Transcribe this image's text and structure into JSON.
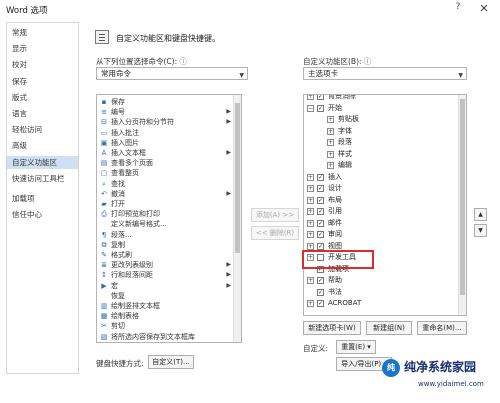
{
  "window": {
    "title": "Word 选项",
    "help_label": "?",
    "close_label": "✕"
  },
  "sidebar": {
    "items": [
      {
        "label": "常规",
        "selected": false
      },
      {
        "label": "显示",
        "selected": false
      },
      {
        "label": "校对",
        "selected": false
      },
      {
        "label": "保存",
        "selected": false
      },
      {
        "label": "版式",
        "selected": false
      },
      {
        "label": "语言",
        "selected": false
      },
      {
        "label": "轻松访问",
        "selected": false
      },
      {
        "label": "高级",
        "selected": false
      },
      {
        "label": "自定义功能区",
        "selected": true
      },
      {
        "label": "快速访问工具栏",
        "selected": false
      },
      {
        "label": "加载项",
        "selected": false
      },
      {
        "label": "信任中心",
        "selected": false
      }
    ]
  },
  "header": {
    "text": "自定义功能区和键盘快捷键。"
  },
  "left_panel": {
    "choose_label": "从下列位置选择命令(C):",
    "info_icon": "ⓘ",
    "choose_value": "常用命令",
    "commands": [
      {
        "label": "保存",
        "icon": "▪",
        "has_submenu": false
      },
      {
        "label": "编号",
        "icon": "≡",
        "has_submenu": true
      },
      {
        "label": "插入分页符和分节符",
        "icon": "⊟",
        "has_submenu": true
      },
      {
        "label": "插入批注",
        "icon": "▭",
        "has_submenu": false
      },
      {
        "label": "插入图片",
        "icon": "▣",
        "has_submenu": false
      },
      {
        "label": "插入文本框",
        "icon": "A",
        "has_submenu": true
      },
      {
        "label": "查看多个页面",
        "icon": "▤",
        "has_submenu": false
      },
      {
        "label": "查看整页",
        "icon": "▢",
        "has_submenu": false
      },
      {
        "label": "查找",
        "icon": "⌕",
        "has_submenu": false
      },
      {
        "label": "撤消",
        "icon": "↶",
        "has_submenu": true
      },
      {
        "label": "打开",
        "icon": "▰",
        "has_submenu": false
      },
      {
        "label": "打印预览和打印",
        "icon": "⎙",
        "has_submenu": false
      },
      {
        "label": "定义新编号格式...",
        "icon": "",
        "has_submenu": false
      },
      {
        "label": "段落...",
        "icon": "¶",
        "has_submenu": false
      },
      {
        "label": "复制",
        "icon": "⧉",
        "has_submenu": false
      },
      {
        "label": "格式刷",
        "icon": "✎",
        "has_submenu": false
      },
      {
        "label": "更改列表级别",
        "icon": "≣",
        "has_submenu": true
      },
      {
        "label": "行和段落间距",
        "icon": "↕",
        "has_submenu": true
      },
      {
        "label": "宏",
        "icon": "▶",
        "has_submenu": true
      },
      {
        "label": "恢复",
        "icon": "",
        "has_submenu": false
      },
      {
        "label": "绘制竖排文本框",
        "icon": "▥",
        "has_submenu": false
      },
      {
        "label": "绘制表格",
        "icon": "▦",
        "has_submenu": false
      },
      {
        "label": "剪切",
        "icon": "✂",
        "has_submenu": false
      },
      {
        "label": "将所选内容保存到文本框库",
        "icon": "▧",
        "has_submenu": false
      }
    ],
    "shortcut_label": "键盘快捷方式:",
    "customize_button": "自定义(T)..."
  },
  "middle": {
    "add_button": "添加(A) >>",
    "remove_button": "<< 删除(R)"
  },
  "right_panel": {
    "customize_label": "自定义功能区(B):",
    "info_icon": "ⓘ",
    "tabs_value": "主选项卡",
    "tree": [
      {
        "label": "背景消除",
        "level": 0,
        "expander": "+",
        "checked": true
      },
      {
        "label": "开始",
        "level": 0,
        "expander": "−",
        "checked": true
      },
      {
        "label": "剪贴板",
        "level": 1,
        "expander": "+",
        "checked": null
      },
      {
        "label": "字体",
        "level": 1,
        "expander": "+",
        "checked": null
      },
      {
        "label": "段落",
        "level": 1,
        "expander": "+",
        "checked": null
      },
      {
        "label": "样式",
        "level": 1,
        "expander": "+",
        "checked": null
      },
      {
        "label": "编辑",
        "level": 1,
        "expander": "+",
        "checked": null
      },
      {
        "label": "插入",
        "level": 0,
        "expander": "+",
        "checked": true
      },
      {
        "label": "设计",
        "level": 0,
        "expander": "+",
        "checked": true
      },
      {
        "label": "布局",
        "level": 0,
        "expander": "+",
        "checked": true
      },
      {
        "label": "引用",
        "level": 0,
        "expander": "+",
        "checked": true
      },
      {
        "label": "邮件",
        "level": 0,
        "expander": "+",
        "checked": true
      },
      {
        "label": "审阅",
        "level": 0,
        "expander": "+",
        "checked": true
      },
      {
        "label": "视图",
        "level": 0,
        "expander": "+",
        "checked": true
      },
      {
        "label": "开发工具",
        "level": 0,
        "expander": "+",
        "checked": false
      },
      {
        "label": "加载项",
        "level": 0,
        "expander": "",
        "checked": true
      },
      {
        "label": "帮助",
        "level": 0,
        "expander": "+",
        "checked": true
      },
      {
        "label": "书法",
        "level": 0,
        "expander": "",
        "checked": true
      },
      {
        "label": "ACROBAT",
        "level": 0,
        "expander": "+",
        "checked": true
      }
    ],
    "new_tab_button": "新建选项卡(W)",
    "new_group_button": "新建组(N)",
    "rename_button": "重命名(M)...",
    "custom_label": "自定义:",
    "reset_button": "重置(E) ▾",
    "import_export_button": "导入/导出(P) ▾",
    "move_up_icon": "▲",
    "move_down_icon": "▼"
  },
  "watermark": {
    "logo": "纯",
    "title": "纯净系统家园",
    "url": "www.yidaimei.com"
  },
  "colors": {
    "highlight": "#e0292e",
    "selection": "#cfe0f4",
    "watermark": "#1a2f6d"
  }
}
